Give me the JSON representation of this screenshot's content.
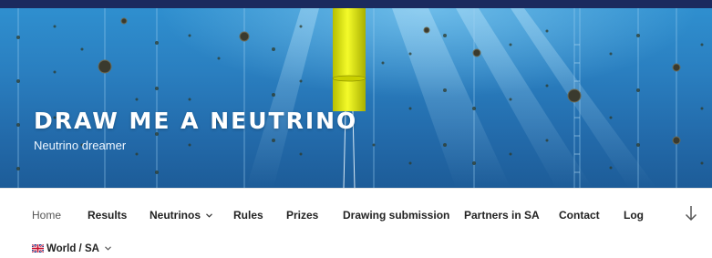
{
  "site": {
    "title": "DRAW ME A NEUTRINO",
    "tagline": "Neutrino dreamer"
  },
  "nav": {
    "items": [
      {
        "label": "Home"
      },
      {
        "label": "Results"
      },
      {
        "label": "Neutrinos"
      },
      {
        "label": "Rules"
      },
      {
        "label": "Prizes"
      },
      {
        "label": "Drawing submission"
      },
      {
        "label": "Partners in SA"
      },
      {
        "label": "Contact"
      },
      {
        "label": "Log"
      }
    ],
    "language": "World / SA"
  },
  "icons": {
    "dropdown": "chevron-down-icon",
    "scroll": "arrow-down-icon",
    "flag": "uk-flag-icon"
  },
  "colors": {
    "topbar": "#1b2a5e",
    "water": "#2a7fc0",
    "buoy": "#e8f000"
  }
}
